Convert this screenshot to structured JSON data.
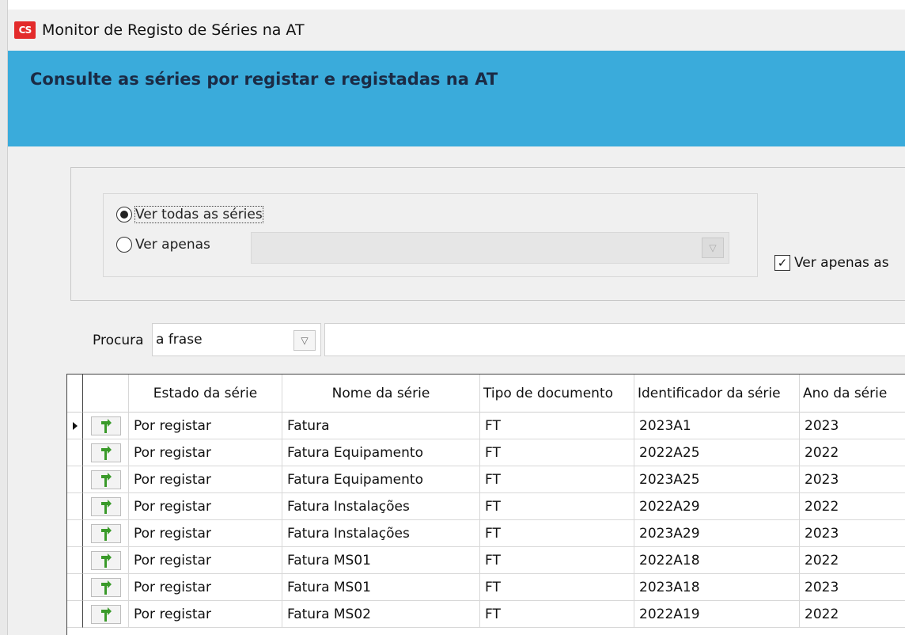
{
  "window": {
    "icon_text": "CS",
    "title": "Monitor de Registo de Séries na AT"
  },
  "banner": {
    "text": "Consulte as séries por registar e registadas na AT"
  },
  "filter": {
    "radio_all_label": "Ver todas as séries",
    "radio_all_selected": true,
    "radio_only_label": "Ver apenas",
    "radio_only_selected": false,
    "only_combo_value": "",
    "checkbox_label": "Ver apenas as",
    "checkbox_checked": true
  },
  "search": {
    "label": "Procura",
    "mode_value": "a frase",
    "query_value": ""
  },
  "grid": {
    "columns": [
      "",
      "Estado da série",
      "Nome da série",
      "Tipo de documento",
      "Identificador da série",
      "Ano da série"
    ],
    "rows": [
      {
        "status": "Por registar",
        "name": "Fatura",
        "doc_type": "FT",
        "identifier": "2023A1",
        "year": "2023",
        "current": true
      },
      {
        "status": "Por registar",
        "name": "Fatura Equipamento",
        "doc_type": "FT",
        "identifier": "2022A25",
        "year": "2022",
        "current": false
      },
      {
        "status": "Por registar",
        "name": "Fatura Equipamento",
        "doc_type": "FT",
        "identifier": "2023A25",
        "year": "2023",
        "current": false
      },
      {
        "status": "Por registar",
        "name": "Fatura Instalações",
        "doc_type": "FT",
        "identifier": "2022A29",
        "year": "2022",
        "current": false
      },
      {
        "status": "Por registar",
        "name": "Fatura Instalações",
        "doc_type": "FT",
        "identifier": "2023A29",
        "year": "2023",
        "current": false
      },
      {
        "status": "Por registar",
        "name": "Fatura MS01",
        "doc_type": "FT",
        "identifier": "2022A18",
        "year": "2022",
        "current": false
      },
      {
        "status": "Por registar",
        "name": "Fatura MS01",
        "doc_type": "FT",
        "identifier": "2023A18",
        "year": "2023",
        "current": false
      },
      {
        "status": "Por registar",
        "name": "Fatura MS02",
        "doc_type": "FT",
        "identifier": "2022A19",
        "year": "2022",
        "current": false
      }
    ],
    "row_action_icon": "register-icon"
  },
  "colors": {
    "banner": "#3aabdb",
    "banner_text": "#1b2b45",
    "app_icon": "#e32b2b",
    "register_icon": "#3a9a2a"
  }
}
